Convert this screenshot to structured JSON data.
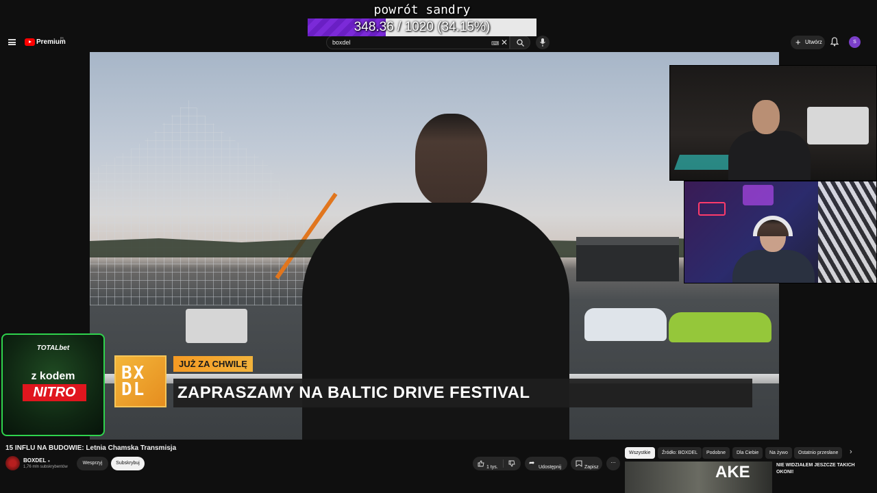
{
  "goal": {
    "title": "powrót sandry",
    "text": "348.36 / 1020 (34.15%)",
    "progress": 0.3415,
    "fill_color": "#7b2ad8"
  },
  "masthead": {
    "logo_text": "Premium",
    "country_code": "PL",
    "search_value": "boxdel",
    "create_label": "Utwórz",
    "avatar_letter": "S",
    "icons": [
      "menu-icon",
      "youtube-logo",
      "keyboard-icon",
      "clear-icon",
      "search-icon",
      "mic-icon",
      "plus-icon",
      "bell-icon"
    ]
  },
  "overlay": {
    "logo_text": "BX\nDL",
    "tag": "JUŻ ZA CHWILĘ",
    "headline": "ZAPRASZAMY NA BALTIC DRIVE FESTIVAL"
  },
  "sponsor": {
    "brand": "TOTALbet",
    "line1": "z kodem",
    "line2": "NITRO",
    "accent": "#2fd44d"
  },
  "video_info": {
    "title": "15 INFLU NA BUDOWIE: Letnia Chamska Transmisja",
    "channel": "BOXDEL",
    "subs": "1,76 mln subskrybentów",
    "support_label": "Wesprzyj",
    "subscribe_label": "Subskrybuj",
    "likes": "1 tys.",
    "share_label": "Udostępnij",
    "save_label": "Zapisz"
  },
  "sidebar": {
    "chips": [
      "Wszystkie",
      "Źródło: BOXDEL",
      "Podobne",
      "Dla Ciebie",
      "Na żywo",
      "Ostatnio przesłane"
    ],
    "rec_title": "NIE WIDZIAŁEM JESZCZE TAKICH OKONI!",
    "rec_thumb_text": "AKE"
  }
}
